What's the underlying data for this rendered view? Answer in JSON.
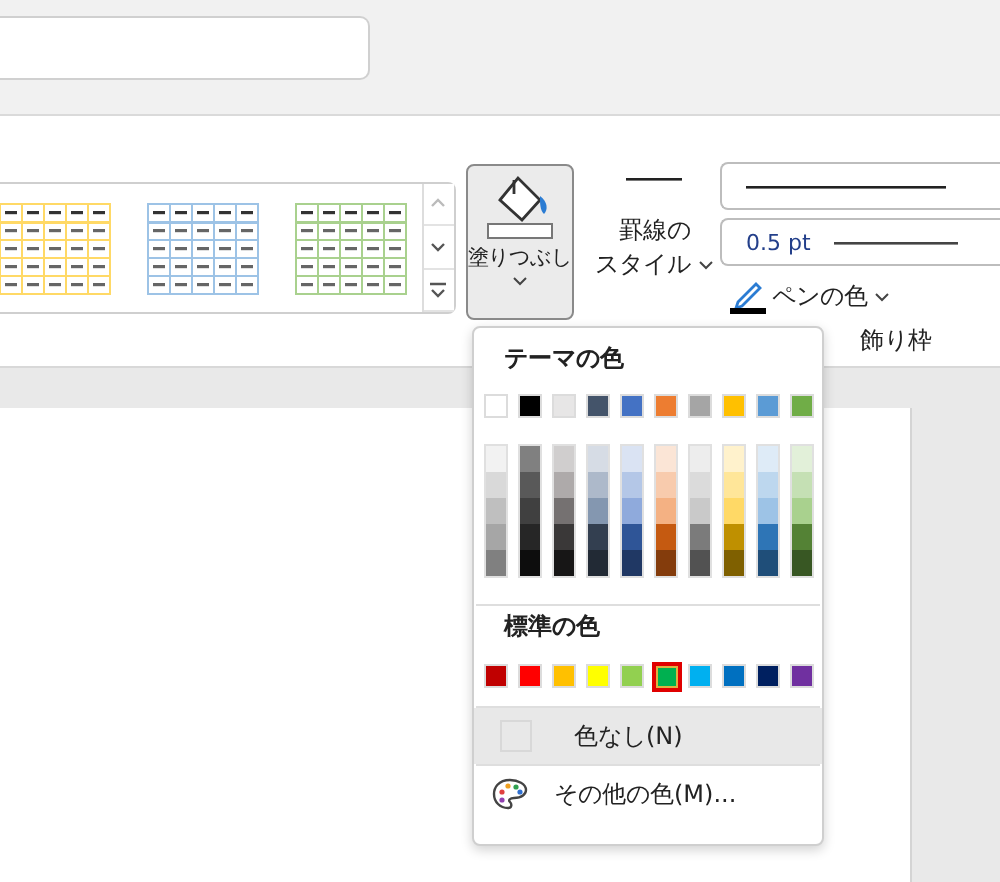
{
  "ribbon": {
    "table_styles": [
      {
        "color": "#ffd966"
      },
      {
        "color": "#9dc3e6"
      },
      {
        "color": "#a9d18e"
      }
    ],
    "fill_button": {
      "label": "塗りつぶし",
      "pressed": true
    },
    "line_style": {
      "label_lines": [
        "罫線の",
        "スタイル"
      ]
    },
    "pen_weight": "0.5 pt",
    "pen_color": {
      "label": "ペンの色",
      "color": "#000000"
    },
    "group_label": "飾り枠"
  },
  "color_menu": {
    "theme_heading": "テーマの色",
    "theme_colors": [
      {
        "color": "#ffffff",
        "shades": [
          {
            "color": "#f2f2f2"
          },
          {
            "color": "#d9d9d9"
          },
          {
            "color": "#bfbfbf"
          },
          {
            "color": "#a6a6a6"
          },
          {
            "color": "#808080"
          }
        ]
      },
      {
        "color": "#000000",
        "shades": [
          {
            "color": "#808080"
          },
          {
            "color": "#595959"
          },
          {
            "color": "#404040"
          },
          {
            "color": "#262626"
          },
          {
            "color": "#0d0d0d"
          }
        ]
      },
      {
        "color": "#e7e6e6",
        "shades": [
          {
            "color": "#d0cece"
          },
          {
            "color": "#aeaaaa"
          },
          {
            "color": "#757171"
          },
          {
            "color": "#3a3838"
          },
          {
            "color": "#171616"
          }
        ]
      },
      {
        "color": "#44546a",
        "shades": [
          {
            "color": "#d6dce5"
          },
          {
            "color": "#adb9ca"
          },
          {
            "color": "#8497b0"
          },
          {
            "color": "#333f50"
          },
          {
            "color": "#222a35"
          }
        ]
      },
      {
        "color": "#4472c4",
        "shades": [
          {
            "color": "#dae3f3"
          },
          {
            "color": "#b4c7e7"
          },
          {
            "color": "#8faadc"
          },
          {
            "color": "#2f5597"
          },
          {
            "color": "#203864"
          }
        ]
      },
      {
        "color": "#ed7d31",
        "shades": [
          {
            "color": "#fbe5d6"
          },
          {
            "color": "#f8cbad"
          },
          {
            "color": "#f4b183"
          },
          {
            "color": "#c55a11"
          },
          {
            "color": "#843c0c"
          }
        ]
      },
      {
        "color": "#a5a5a5",
        "shades": [
          {
            "color": "#ededed"
          },
          {
            "color": "#dbdbdb"
          },
          {
            "color": "#c9c9c9"
          },
          {
            "color": "#7b7b7b"
          },
          {
            "color": "#525252"
          }
        ]
      },
      {
        "color": "#ffc000",
        "shades": [
          {
            "color": "#fff2cc"
          },
          {
            "color": "#ffe699"
          },
          {
            "color": "#ffd966"
          },
          {
            "color": "#bf9000"
          },
          {
            "color": "#7f6000"
          }
        ]
      },
      {
        "color": "#5b9bd5",
        "shades": [
          {
            "color": "#deebf7"
          },
          {
            "color": "#bdd7ee"
          },
          {
            "color": "#9dc3e6"
          },
          {
            "color": "#2e75b6"
          },
          {
            "color": "#1f4e79"
          }
        ]
      },
      {
        "color": "#70ad47",
        "shades": [
          {
            "color": "#e2f0d9"
          },
          {
            "color": "#c5e0b4"
          },
          {
            "color": "#a9d18e"
          },
          {
            "color": "#548235"
          },
          {
            "color": "#385723"
          }
        ]
      }
    ],
    "standard_heading": "標準の色",
    "standard_colors": [
      {
        "color": "#c00000",
        "selected": false
      },
      {
        "color": "#ff0000",
        "selected": false
      },
      {
        "color": "#ffc000",
        "selected": false
      },
      {
        "color": "#ffff00",
        "selected": false
      },
      {
        "color": "#92d050",
        "selected": false
      },
      {
        "color": "#00b050",
        "selected": true
      },
      {
        "color": "#00b0f0",
        "selected": false
      },
      {
        "color": "#0070c0",
        "selected": false
      },
      {
        "color": "#002060",
        "selected": false
      },
      {
        "color": "#7030a0",
        "selected": false
      }
    ],
    "items": [
      {
        "kind": "no-color",
        "label": "色なし(N)",
        "highlighted": true
      },
      {
        "kind": "more-colors",
        "label": "その他の色(M)...",
        "highlighted": false
      }
    ]
  }
}
